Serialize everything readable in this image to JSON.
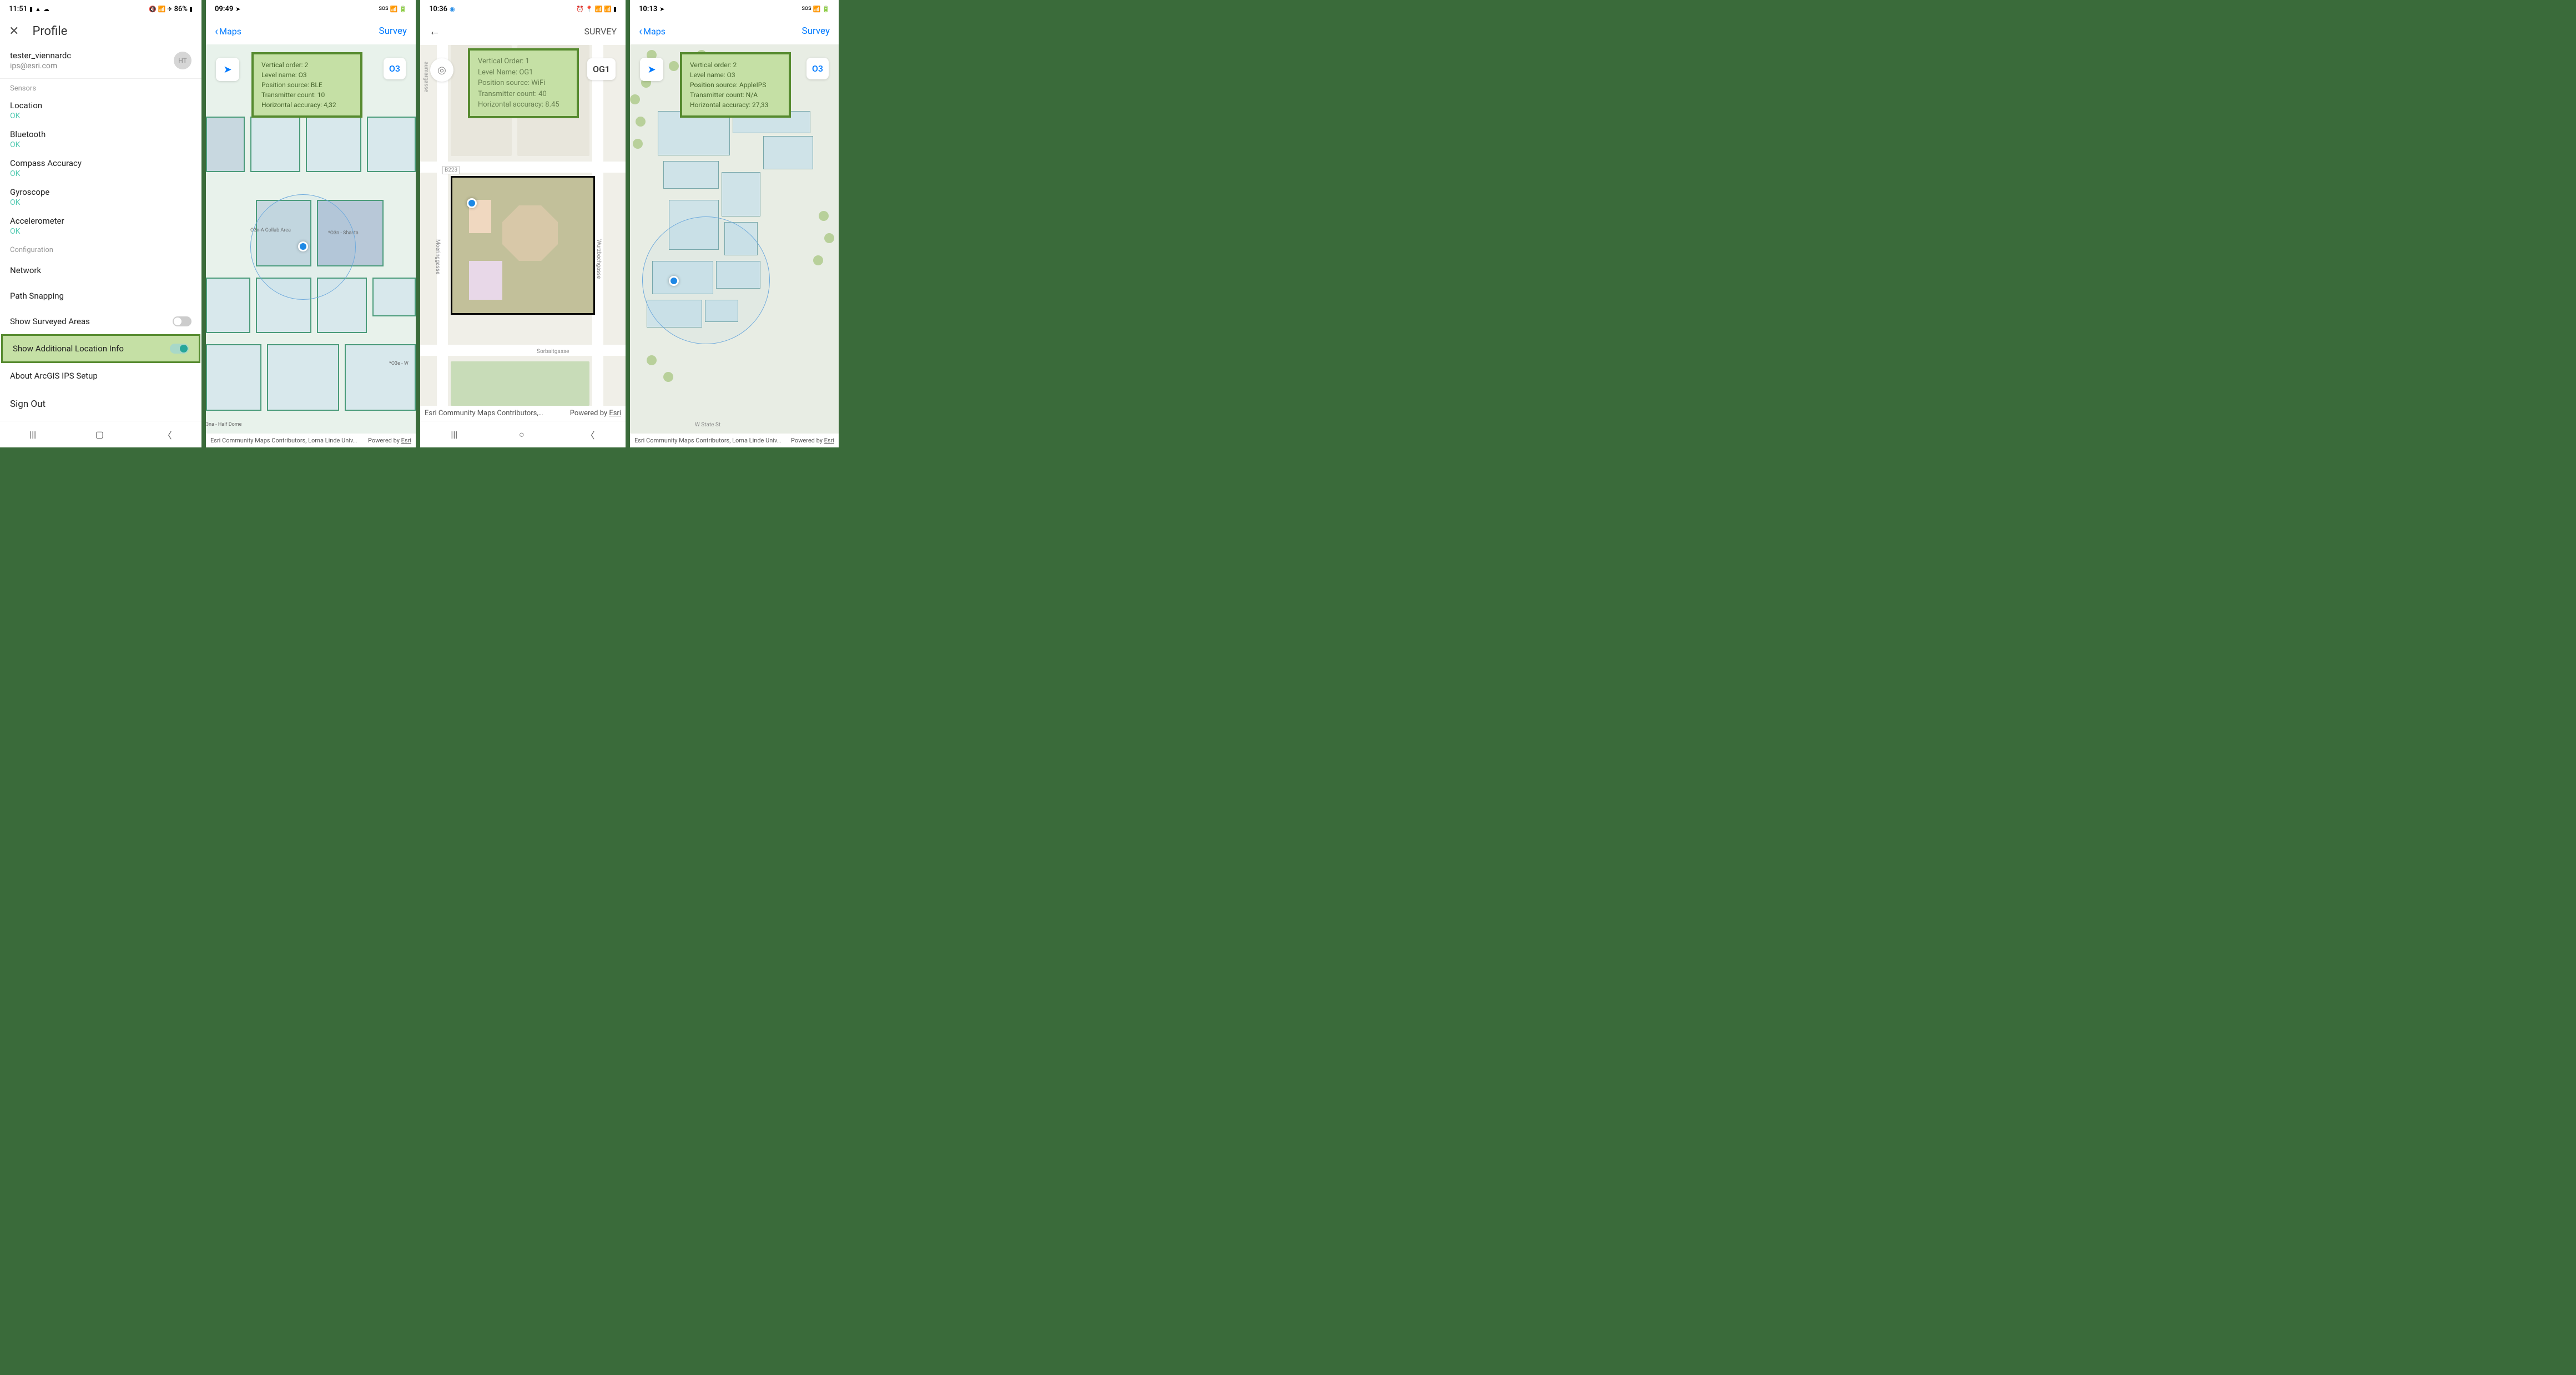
{
  "phone1": {
    "status": {
      "time": "11:51",
      "battery": "86%"
    },
    "header": {
      "title": "Profile"
    },
    "user": {
      "name": "tester_viennardc",
      "email": "ips@esri.com",
      "initials": "HT"
    },
    "sections": {
      "sensors": "Sensors",
      "config": "Configuration"
    },
    "sensors": [
      {
        "name": "Location",
        "status": "OK"
      },
      {
        "name": "Bluetooth",
        "status": "OK"
      },
      {
        "name": "Compass Accuracy",
        "status": "OK"
      },
      {
        "name": "Gyroscope",
        "status": "OK"
      },
      {
        "name": "Accelerometer",
        "status": "OK"
      }
    ],
    "config": {
      "network": "Network",
      "path_snapping": "Path Snapping",
      "show_surveyed": "Show Surveyed Areas",
      "show_additional": "Show Additional Location Info",
      "about": "About ArcGIS IPS Setup",
      "signout": "Sign Out"
    }
  },
  "phone2": {
    "status": {
      "time": "09:49",
      "sos": "SOS"
    },
    "header": {
      "back": "Maps",
      "right": "Survey"
    },
    "floor_badge": "O3",
    "info": {
      "l1": "Vertical order: 2",
      "l2": "Level name: O3",
      "l3": "Position source: BLE",
      "l4": "Transmitter count: 10",
      "l5": "Horizontal accuracy: 4,32"
    },
    "rooms": {
      "collab": "O3n-A Collab Area",
      "shasta": "*O3n - Shasta",
      "o3e": "*O3e - W",
      "halfdome": "3na - Half Dome"
    },
    "attr": {
      "left": "Esri Community Maps Contributors, Loma Linde Univ…",
      "right": "Powered by",
      "esri": "Esri"
    }
  },
  "phone3": {
    "status": {
      "time": "10:36"
    },
    "header": {
      "right": "SURVEY"
    },
    "floor_badge": "OG1",
    "info": {
      "l1": "Vertical Order: 1",
      "l2": "Level Name: OG1",
      "l3": "Position source: WiFi",
      "l4": "Transmitter count: 40",
      "l5": "Horizontal accuracy: 8.45"
    },
    "streets": {
      "b223": "B223",
      "moering": "Moeringgasse",
      "wurzbach": "Wurzbachgasse",
      "sorbait": "Sorbaitgasse",
      "saumarg": "aumargasse"
    },
    "attr": {
      "left": "Esri Community Maps Contributors,…",
      "right": "Powered by",
      "esri": "Esri"
    }
  },
  "phone4": {
    "status": {
      "time": "10:13",
      "sos": "SOS"
    },
    "header": {
      "back": "Maps",
      "right": "Survey"
    },
    "floor_badge": "O3",
    "info": {
      "l1": "Vertical order: 2",
      "l2": "Level name: O3",
      "l3": "Position source: AppleIPS",
      "l4": "Transmitter count: N/A",
      "l5": "Horizontal accuracy: 27,33"
    },
    "street": "W State St",
    "attr": {
      "left": "Esri Community Maps Contributors, Loma Linde Univ…",
      "right": "Powered by",
      "esri": "Esri"
    }
  }
}
